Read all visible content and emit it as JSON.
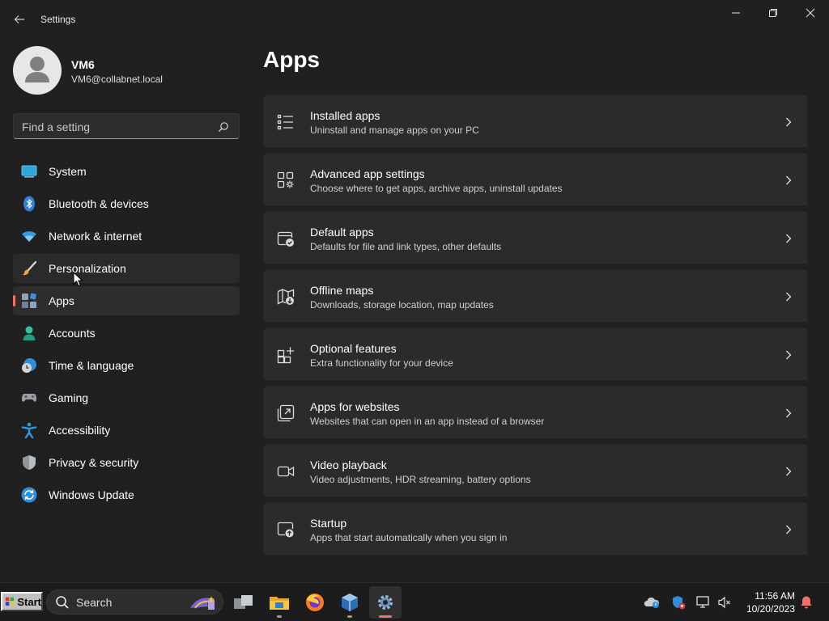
{
  "window": {
    "title": "Settings",
    "back_icon": "back-arrow-icon",
    "controls": [
      "minimize-icon",
      "restore-icon",
      "close-icon"
    ]
  },
  "profile": {
    "name": "VM6",
    "email": "VM6@collabnet.local"
  },
  "search": {
    "placeholder": "Find a setting"
  },
  "nav": {
    "items": [
      {
        "label": "System",
        "icon": "system-monitor-icon",
        "state": ""
      },
      {
        "label": "Bluetooth & devices",
        "icon": "bluetooth-icon",
        "state": ""
      },
      {
        "label": "Network & internet",
        "icon": "wifi-icon",
        "state": ""
      },
      {
        "label": "Personalization",
        "icon": "paintbrush-icon",
        "state": "hover"
      },
      {
        "label": "Apps",
        "icon": "apps-icon",
        "state": "active"
      },
      {
        "label": "Accounts",
        "icon": "accounts-person-icon",
        "state": ""
      },
      {
        "label": "Time & language",
        "icon": "clock-globe-icon",
        "state": ""
      },
      {
        "label": "Gaming",
        "icon": "gamepad-icon",
        "state": ""
      },
      {
        "label": "Accessibility",
        "icon": "accessibility-icon",
        "state": ""
      },
      {
        "label": "Privacy & security",
        "icon": "shield-icon",
        "state": ""
      },
      {
        "label": "Windows Update",
        "icon": "update-sync-icon",
        "state": ""
      }
    ]
  },
  "main": {
    "title": "Apps",
    "cards": [
      {
        "title": "Installed apps",
        "subtitle": "Uninstall and manage apps on your PC",
        "icon": "installed-apps-list-icon"
      },
      {
        "title": "Advanced app settings",
        "subtitle": "Choose where to get apps, archive apps, uninstall updates",
        "icon": "advanced-app-settings-icon"
      },
      {
        "title": "Default apps",
        "subtitle": "Defaults for file and link types, other defaults",
        "icon": "default-apps-icon"
      },
      {
        "title": "Offline maps",
        "subtitle": "Downloads, storage location, map updates",
        "icon": "offline-maps-icon"
      },
      {
        "title": "Optional features",
        "subtitle": "Extra functionality for your device",
        "icon": "optional-features-icon"
      },
      {
        "title": "Apps for websites",
        "subtitle": "Websites that can open in an app instead of a browser",
        "icon": "apps-for-websites-icon"
      },
      {
        "title": "Video playback",
        "subtitle": "Video adjustments, HDR streaming, battery options",
        "icon": "video-camera-icon"
      },
      {
        "title": "Startup",
        "subtitle": "Apps that start automatically when you sign in",
        "icon": "startup-icon"
      }
    ]
  },
  "taskbar": {
    "start_label": "Start",
    "search_label": "Search",
    "apps": [
      {
        "name": "task-view-icon",
        "active": false
      },
      {
        "name": "file-explorer-icon",
        "active": false
      },
      {
        "name": "firefox-icon",
        "active": false
      },
      {
        "name": "virtualbox-icon",
        "active": false
      },
      {
        "name": "settings-gear-icon",
        "active": true
      }
    ],
    "tray": [
      "onedrive-cloud-icon",
      "defender-shield-icon",
      "network-icon",
      "volume-muted-icon"
    ],
    "time": "11:56 AM",
    "date": "10/20/2023",
    "notification_icon": "notification-bell-icon"
  },
  "colors": {
    "background": "#202020",
    "card": "#2b2b2b",
    "accent": "#f0706a"
  }
}
